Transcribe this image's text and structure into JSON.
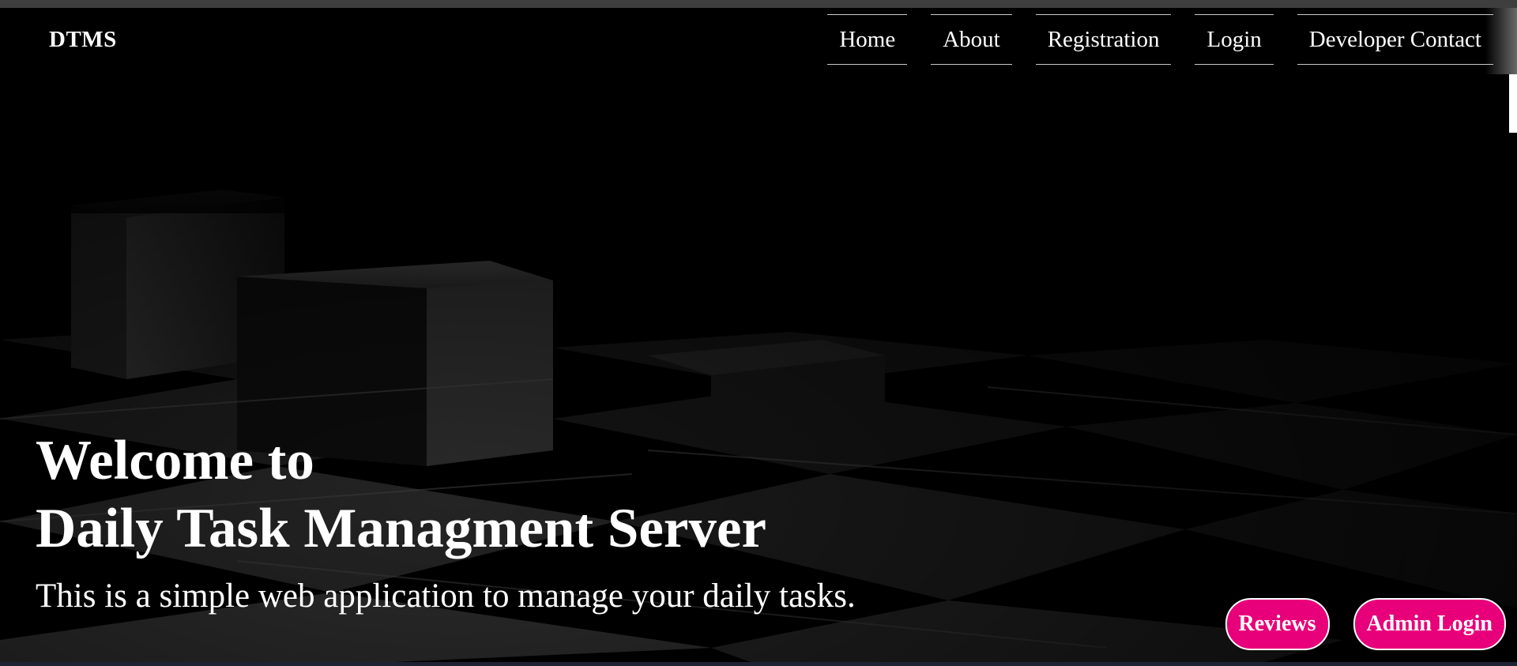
{
  "brand": "DTMS",
  "nav": {
    "items": [
      {
        "label": "Home"
      },
      {
        "label": "About"
      },
      {
        "label": "Registration"
      },
      {
        "label": "Login"
      },
      {
        "label": "Developer Contact"
      }
    ]
  },
  "hero": {
    "title_line1": "Welcome to",
    "title_line2": "Daily Task Managment Server",
    "subtitle": "This is a simple web application to manage your daily tasks."
  },
  "actions": {
    "reviews_label": "Reviews",
    "admin_login_label": "Admin Login"
  },
  "colors": {
    "background": "#000000",
    "accent": "#e8007a",
    "text": "#ffffff"
  }
}
